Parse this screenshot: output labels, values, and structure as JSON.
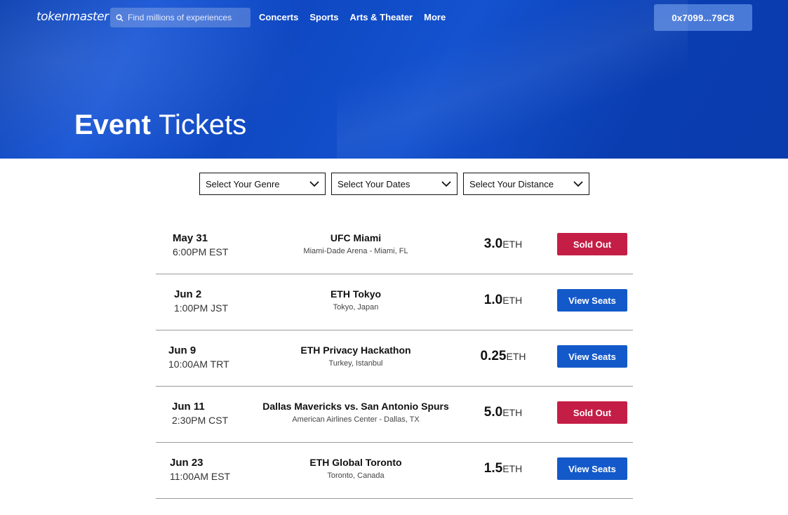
{
  "header": {
    "logo": "tokenmaster",
    "search_placeholder": "Find millions of experiences",
    "nav": [
      "Concerts",
      "Sports",
      "Arts & Theater",
      "More"
    ],
    "wallet": "0x7099...79C8"
  },
  "hero": {
    "title_bold": "Event",
    "title_light": "Tickets"
  },
  "filters": [
    "Select Your Genre",
    "Select Your Dates",
    "Select Your Distance"
  ],
  "events": [
    {
      "date": "May 31",
      "time": "6:00PM EST",
      "name": "UFC Miami",
      "venue": "Miami-Dade Arena - Miami, FL",
      "price": "3.0",
      "unit": "ETH",
      "action": "Sold Out",
      "status": "sold"
    },
    {
      "date": "Jun 2",
      "time": "1:00PM JST",
      "name": "ETH Tokyo",
      "venue": "Tokyo, Japan",
      "price": "1.0",
      "unit": "ETH",
      "action": "View Seats",
      "status": "available"
    },
    {
      "date": "Jun 9",
      "time": "10:00AM TRT",
      "name": "ETH Privacy Hackathon",
      "venue": "Turkey, Istanbul",
      "price": "0.25",
      "unit": "ETH",
      "action": "View Seats",
      "status": "available"
    },
    {
      "date": "Jun 11",
      "time": "2:30PM CST",
      "name": "Dallas Mavericks vs. San Antonio Spurs",
      "venue": "American Airlines Center - Dallas, TX",
      "price": "5.0",
      "unit": "ETH",
      "action": "Sold Out",
      "status": "sold"
    },
    {
      "date": "Jun 23",
      "time": "11:00AM EST",
      "name": "ETH Global Toronto",
      "venue": "Toronto, Canada",
      "price": "1.5",
      "unit": "ETH",
      "action": "View Seats",
      "status": "available"
    }
  ],
  "colors": {
    "hero_blue": "#0f48c2",
    "sold_red": "#c41e46",
    "view_blue": "#1359c9"
  }
}
